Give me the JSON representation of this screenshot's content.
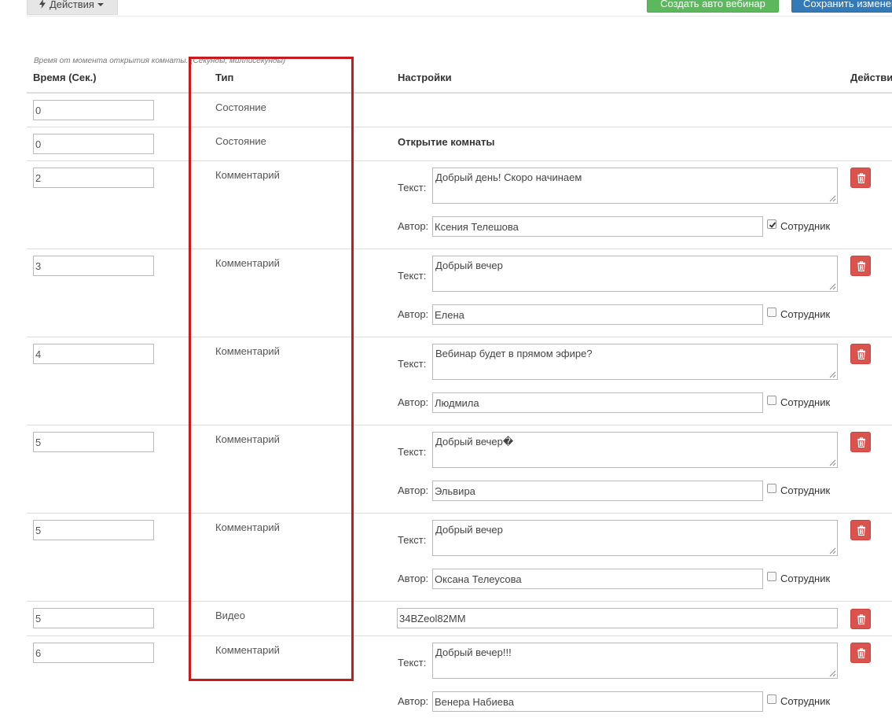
{
  "toolbar": {
    "actions_label": "Действия",
    "create_button_label": "Создать авто вебинар",
    "save_button_label": "Сохранить изменения"
  },
  "table": {
    "hint": "Время от момента открытия комнаты. (Секунды, миллисекунды)",
    "headers": {
      "time": "Время (Сек.)",
      "type": "Тип",
      "settings": "Настройки",
      "actions": "Действия"
    },
    "labels": {
      "text": "Текст:",
      "author": "Автор:",
      "employee": "Сотрудник"
    },
    "rows": [
      {
        "time": "0",
        "type": "Состояние",
        "setting": ""
      },
      {
        "time": "0",
        "type": "Состояние",
        "setting": "Открытие комнаты"
      },
      {
        "time": "2",
        "type": "Комментарий",
        "text": "Добрый день! Скоро начинаем",
        "author": "Ксения Телешова",
        "employee": true
      },
      {
        "time": "3",
        "type": "Комментарий",
        "text": "Добрый вечер",
        "author": "Елена",
        "employee": false
      },
      {
        "time": "4",
        "type": "Комментарий",
        "text": "Вебинар будет в прямом эфире?",
        "author": "Людмила",
        "employee": false
      },
      {
        "time": "5",
        "type": "Комментарий",
        "text": "Добрый вечер�",
        "author": "Эльвира",
        "employee": false
      },
      {
        "time": "5",
        "type": "Комментарий",
        "text": "Добрый вечер",
        "author": "Оксана Телеусова",
        "employee": false
      },
      {
        "time": "5",
        "type": "Видео",
        "video_id": "34BZeol82MM"
      },
      {
        "time": "6",
        "type": "Комментарий",
        "text": "Добрый вечер!!!",
        "author": "Венера Набиева",
        "employee": false
      }
    ]
  },
  "icons": {
    "actions": "bolt-icon",
    "dropdown": "caret-down-icon",
    "delete": "trash-icon",
    "resize": "resize-grip-icon",
    "check": "check-icon"
  },
  "colors": {
    "highlight": "#c9191c",
    "delete_button": "#d9534f",
    "create_button": "#5cb85c",
    "save_button": "#337ab7"
  }
}
